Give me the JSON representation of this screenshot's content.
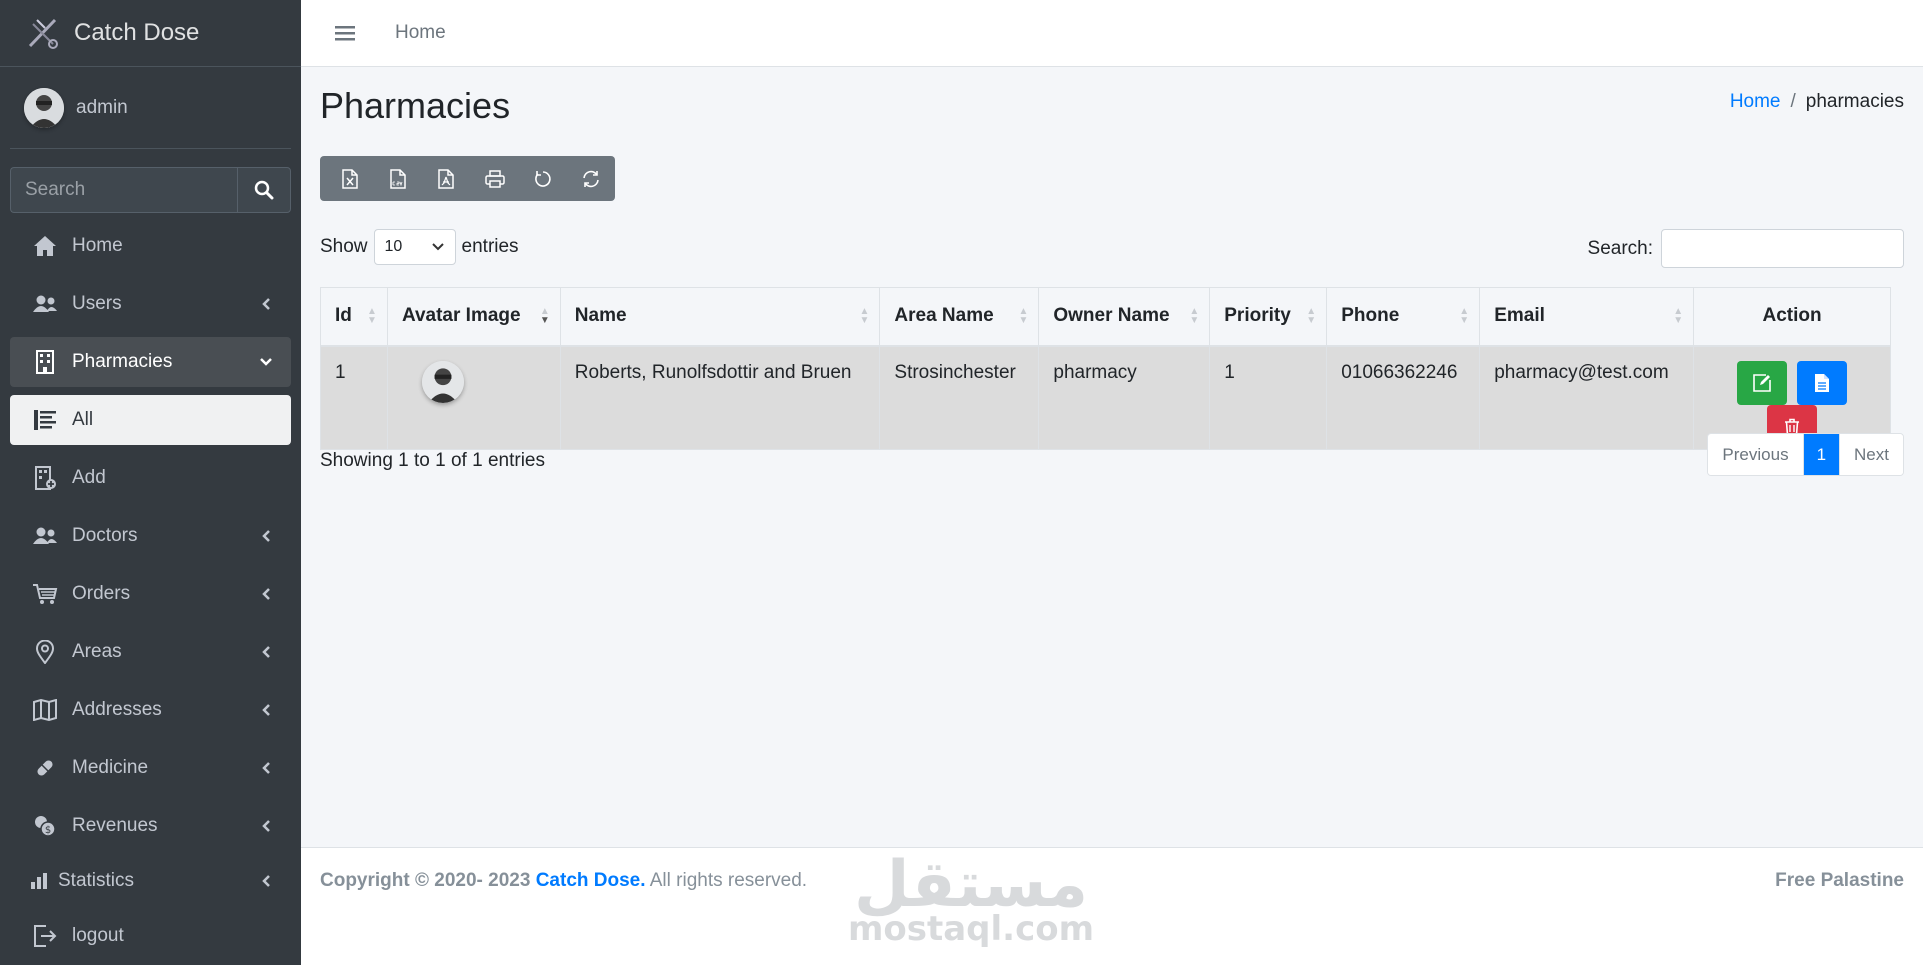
{
  "brand": {
    "name": "Catch Dose"
  },
  "user": {
    "name": "admin"
  },
  "sidebar": {
    "search_placeholder": "Search",
    "items": [
      {
        "label": "Home",
        "icon": "home-icon"
      },
      {
        "label": "Users",
        "icon": "users-icon"
      },
      {
        "label": "Pharmacies",
        "icon": "building-icon"
      },
      {
        "label": "All",
        "icon": "list-icon"
      },
      {
        "label": "Add",
        "icon": "building-add-icon"
      },
      {
        "label": "Doctors",
        "icon": "users-icon"
      },
      {
        "label": "Orders",
        "icon": "cart-icon"
      },
      {
        "label": "Areas",
        "icon": "map-pin-icon"
      },
      {
        "label": "Addresses",
        "icon": "map-icon"
      },
      {
        "label": "Medicine",
        "icon": "pill-icon"
      },
      {
        "label": "Revenues",
        "icon": "coins-icon"
      },
      {
        "label": "Statistics",
        "icon": "bar-chart-icon"
      },
      {
        "label": "logout",
        "icon": "logout-icon"
      }
    ]
  },
  "topbar": {
    "home_link": "Home"
  },
  "page": {
    "title": "Pharmacies",
    "breadcrumb": {
      "home": "Home",
      "sep": "/",
      "current": "pharmacies"
    }
  },
  "export_buttons": [
    "excel-icon",
    "csv-icon",
    "pdf-icon",
    "print-icon",
    "reset-icon",
    "reload-icon"
  ],
  "table_controls": {
    "show": "Show",
    "entries_value": "10",
    "entries": "entries",
    "search_label": "Search:"
  },
  "table": {
    "columns": [
      "Id",
      "Avatar Image",
      "Name",
      "Area Name",
      "Owner Name",
      "Priority",
      "Phone",
      "Email",
      "Action"
    ],
    "rows": [
      {
        "id": "1",
        "name": "Roberts, Runolfsdottir and Bruen",
        "area": "Strosinchester",
        "owner": "pharmacy",
        "priority": "1",
        "phone": "01066362246",
        "email": "pharmacy@test.com"
      }
    ]
  },
  "pagination": {
    "info": "Showing 1 to 1 of 1 entries",
    "previous": "Previous",
    "current": "1",
    "next": "Next"
  },
  "footer": {
    "copyright": "Copyright © 2020- 2023",
    "brand": "Catch Dose.",
    "rights": "All rights reserved.",
    "right_text": "Free Palastine"
  },
  "watermark": {
    "arabic": "مستقل",
    "latin": "mostaql.com"
  },
  "colors": {
    "sidebar_bg": "#343a40",
    "primary": "#007bff",
    "success": "#28a745",
    "danger": "#dc3545",
    "secondary": "#6c757d"
  }
}
